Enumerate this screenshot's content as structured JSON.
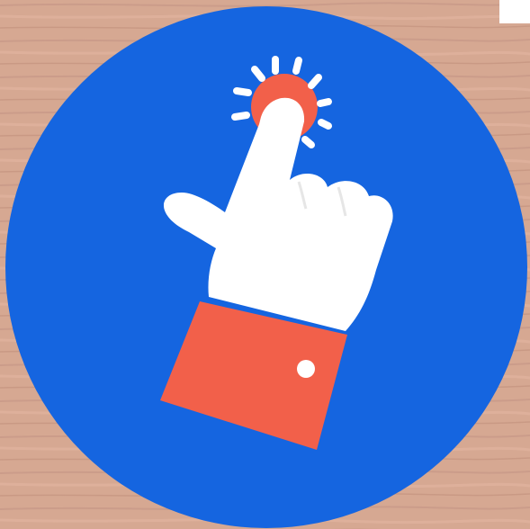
{
  "icon": {
    "name": "tap-gesture-icon",
    "background": "wood-texture"
  },
  "colors": {
    "wood": "#d6a892",
    "wood_dark": "#b98a78",
    "circle": "#1565e0",
    "hand": "#ffffff",
    "sleeve": "#f2604a",
    "tap_point": "#f2604a",
    "button": "#ffffff",
    "rays": "#ffffff"
  }
}
